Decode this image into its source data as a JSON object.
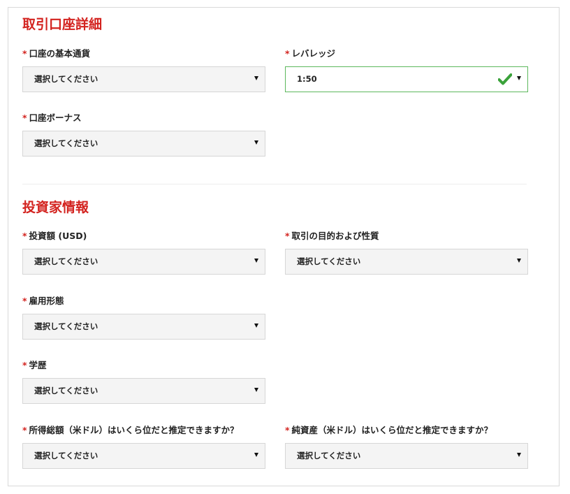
{
  "account_section": {
    "title": "取引口座詳細",
    "base_currency": {
      "label": "口座の基本通貨",
      "value": "選択してください"
    },
    "leverage": {
      "label": "レバレッジ",
      "value": "1:50",
      "status": "valid"
    },
    "bonus": {
      "label": "口座ボーナス",
      "value": "選択してください"
    }
  },
  "investor_section": {
    "title": "投資家情報",
    "investment_amount": {
      "label": "投資額 (USD)",
      "value": "選択してください"
    },
    "trading_purpose": {
      "label": "取引の目的および性質",
      "value": "選択してください"
    },
    "employment": {
      "label": "雇用形態",
      "value": "選択してください"
    },
    "education": {
      "label": "学歴",
      "value": "選択してください"
    },
    "annual_income": {
      "label": "所得総額（米ドル）はいくら位だと推定できますか？",
      "value": "選択してください"
    },
    "net_worth": {
      "label": "純資産（米ドル）はいくら位だと推定できますか？",
      "value": "選択してください"
    }
  },
  "required_marker": "*",
  "colors": {
    "accent_red": "#d3231f",
    "valid_green": "#5cb85c",
    "check_green": "#3aa23a"
  }
}
